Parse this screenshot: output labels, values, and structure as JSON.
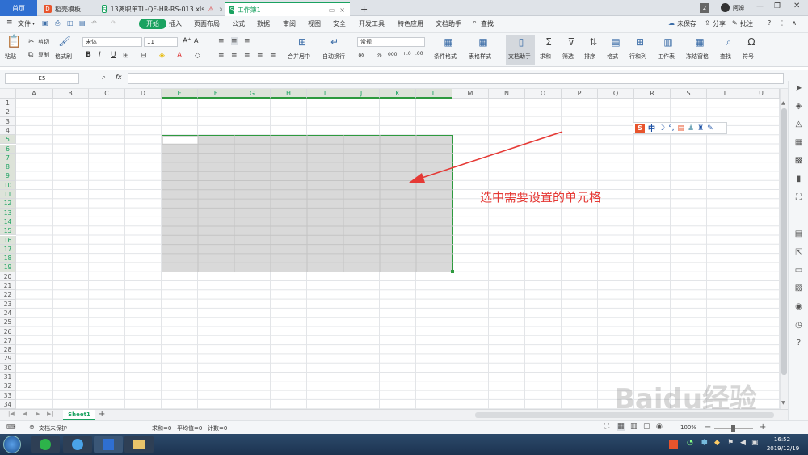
{
  "tabs": {
    "home": "首页",
    "t1": "稻壳模板",
    "t2": "13离职单TL-QF-HR-RS-013.xls",
    "t3": "工作簿1",
    "plus": "+",
    "page_num": "2",
    "user": "阿姆",
    "t2_icon": "S",
    "t3_icon": "S",
    "t1_icon": "D"
  },
  "menu": {
    "file": "文件",
    "start": "开始",
    "items": [
      "插入",
      "页面布局",
      "公式",
      "数据",
      "审阅",
      "视图",
      "安全",
      "开发工具",
      "特色应用",
      "文档助手"
    ],
    "search": "查找",
    "unsaved": "未保存",
    "share": "分享",
    "comment": "批注",
    "help": "?"
  },
  "ribbon": {
    "paste": "粘贴",
    "cut": "剪切",
    "copy": "复制",
    "format_painter": "格式刷",
    "font_name": "宋体",
    "font_size": "11",
    "bold": "B",
    "italic": "I",
    "underline": "U",
    "merge": "合并居中",
    "wrap": "自动换行",
    "number_format": "常规",
    "cond_format": "条件格式",
    "table_style": "表格样式",
    "doc_assist": "文档助手",
    "sum": "求和",
    "filter": "筛选",
    "sort": "排序",
    "format": "格式",
    "rowcol": "行和列",
    "worksheet": "工作表",
    "freeze": "冻结窗格",
    "find": "查找",
    "symbol": "符号",
    "percent": "%",
    "thousands": "000"
  },
  "formula_bar": {
    "name_box": "E5",
    "fx": "fx"
  },
  "columns": [
    "A",
    "B",
    "C",
    "D",
    "E",
    "F",
    "G",
    "H",
    "I",
    "J",
    "K",
    "L",
    "M",
    "N",
    "O",
    "P",
    "Q",
    "R",
    "S",
    "T",
    "U"
  ],
  "rows": [
    "1",
    "2",
    "3",
    "4",
    "5",
    "6",
    "7",
    "8",
    "9",
    "10",
    "11",
    "12",
    "13",
    "14",
    "15",
    "16",
    "17",
    "18",
    "19",
    "20",
    "21",
    "22",
    "23",
    "24",
    "25",
    "26",
    "27",
    "28",
    "29",
    "30",
    "31",
    "32",
    "33",
    "34"
  ],
  "annotation": "选中需要设置的单元格",
  "ime_toolbar": {
    "logo": "S",
    "lang": "中"
  },
  "sheet": {
    "name": "Sheet1",
    "add": "+"
  },
  "status": {
    "protect": "文档未保护",
    "summary": "求和=0   平均值=0   计数=0",
    "zoom": "100%"
  },
  "taskbar": {
    "time": "16:52",
    "date": "2019/12/19"
  },
  "watermark": "Baidu经验",
  "colors": {
    "accent_green": "#1aa260",
    "selection_border": "#2e9a3e",
    "selection_fill": "#d9d9d9",
    "arrow_red": "#e53935",
    "tab_blue": "#2f6fd1"
  }
}
